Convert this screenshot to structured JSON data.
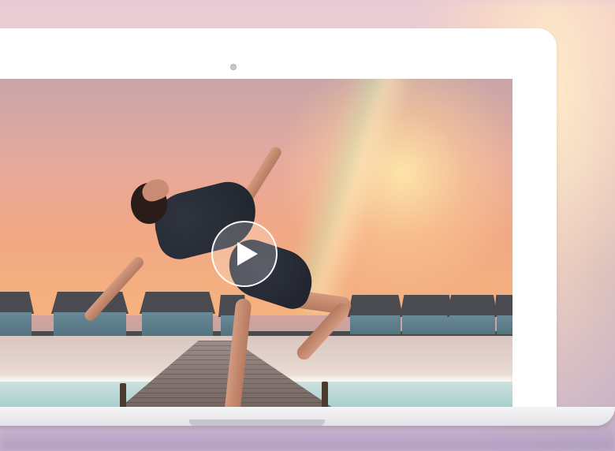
{
  "video_player": {
    "state": "paused",
    "play_icon": "play-icon"
  },
  "colors": {
    "laptop_frame": "#ffffff",
    "laptop_base": "#e3e3e7",
    "play_button_ring": "#ffffff"
  }
}
